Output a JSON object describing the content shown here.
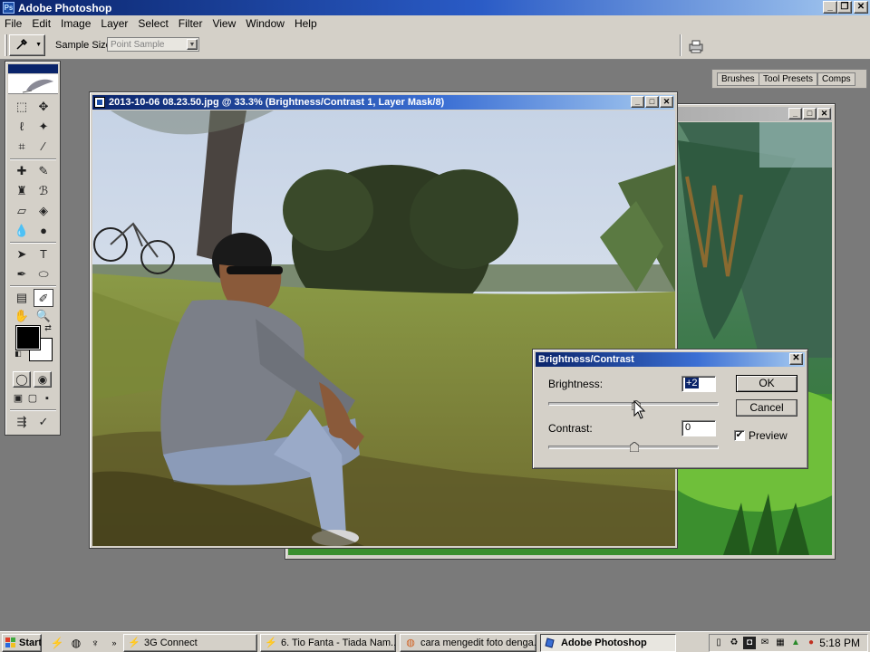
{
  "app": {
    "title": "Adobe Photoshop"
  },
  "menu": [
    "File",
    "Edit",
    "Image",
    "Layer",
    "Select",
    "Filter",
    "View",
    "Window",
    "Help"
  ],
  "options": {
    "sample_size_label": "Sample Size:",
    "sample_size_value": "Point Sample"
  },
  "palette_well": {
    "tabs": [
      "Brushes",
      "Tool Presets",
      "Comps"
    ]
  },
  "document_main": {
    "title": "2013-10-06 08.23.50.jpg @ 33.3% (Brightness/Contrast 1, Layer Mask/8)"
  },
  "dialog": {
    "title": "Brightness/Contrast",
    "brightness_label": "Brightness:",
    "brightness_value": "+2",
    "brightness_level": 2,
    "contrast_label": "Contrast:",
    "contrast_value": "0",
    "contrast_level": 0,
    "ok": "OK",
    "cancel": "Cancel",
    "preview_label": "Preview",
    "preview_checked": true
  },
  "taskbar": {
    "start": "Start",
    "buttons": [
      {
        "label": "3G Connect",
        "icon": "3g-icon"
      },
      {
        "label": "6. Tio Fanta - Tiada Nam...",
        "icon": "winamp-icon"
      },
      {
        "label": "cara mengedit foto denga...",
        "icon": "firefox-icon"
      },
      {
        "label": "Adobe Photoshop",
        "icon": "photoshop-icon"
      }
    ],
    "clock": "5:18 PM"
  },
  "colors": {
    "title_active": "#0a246a",
    "face": "#d4d0c8",
    "workspace": "#7a7a7a"
  }
}
